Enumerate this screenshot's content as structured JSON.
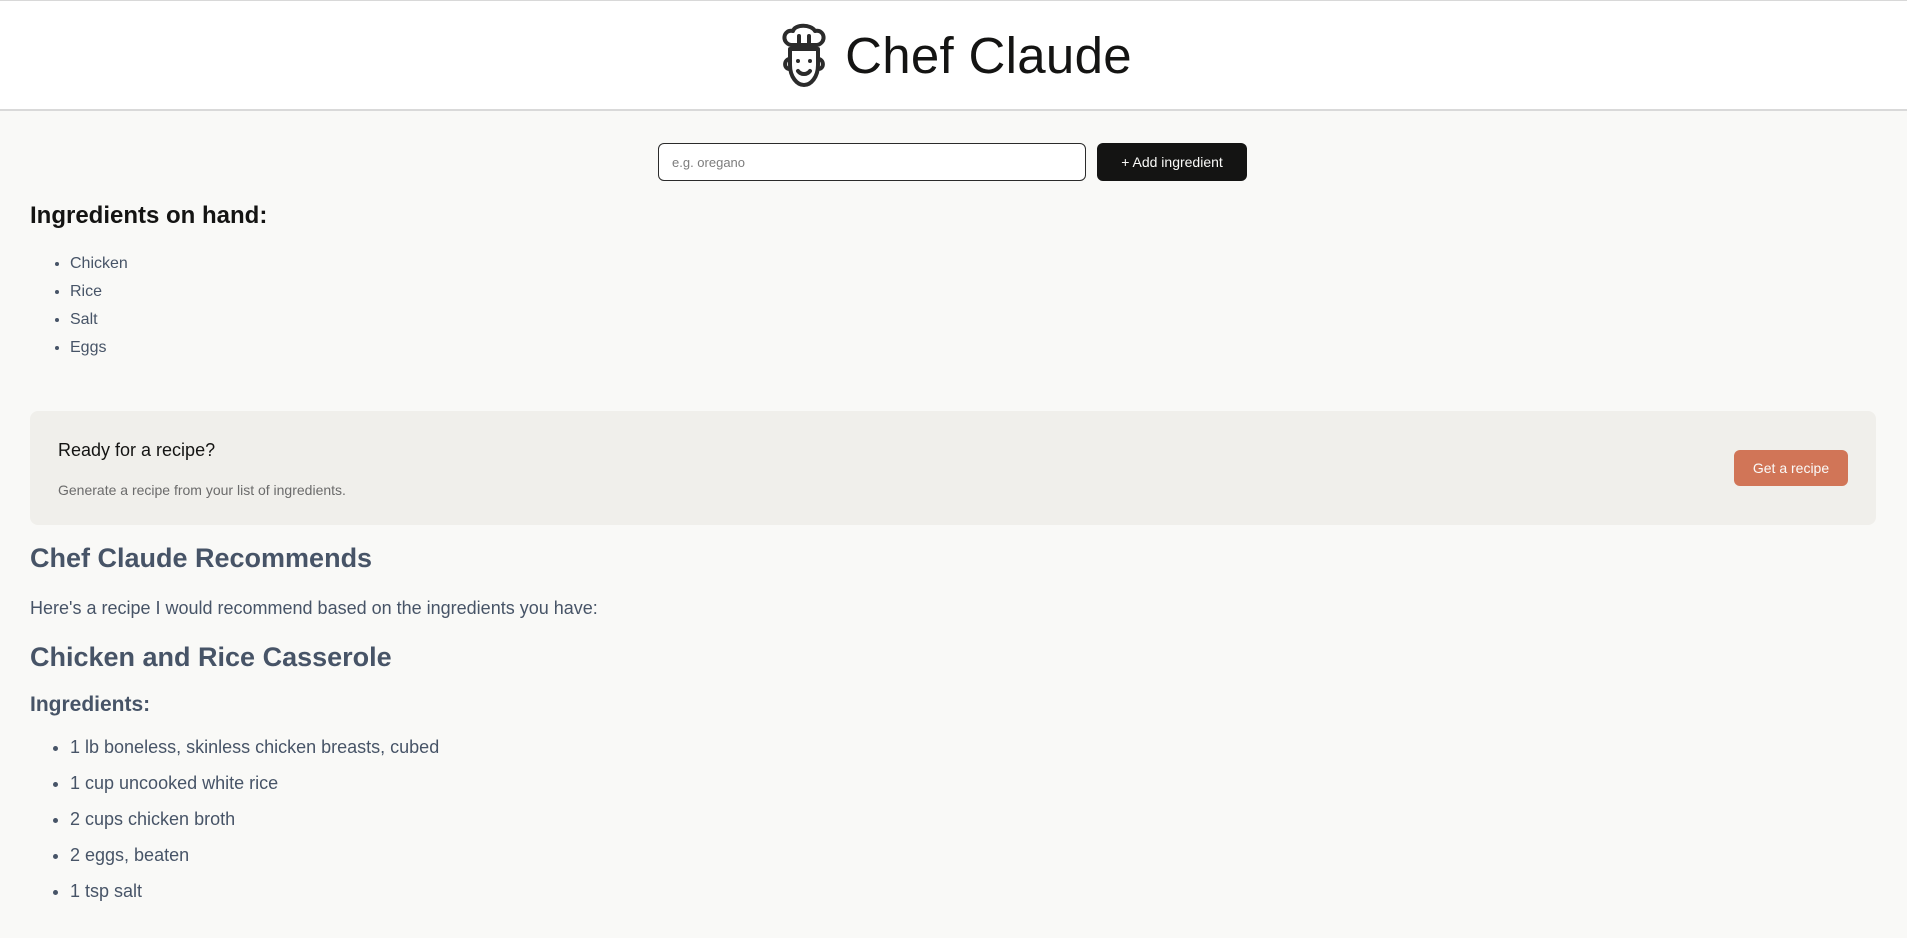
{
  "header": {
    "title": "Chef Claude",
    "logo_icon": "chef-hat-face-icon"
  },
  "add_form": {
    "placeholder": "e.g. oregano",
    "value": "",
    "button_label": "+ Add ingredient"
  },
  "on_hand": {
    "heading": "Ingredients on hand:",
    "items": [
      "Chicken",
      "Rice",
      "Salt",
      "Eggs"
    ]
  },
  "cta": {
    "title": "Ready for a recipe?",
    "subtitle": "Generate a recipe from your list of ingredients.",
    "button_label": "Get a recipe"
  },
  "recipe": {
    "section_heading": "Chef Claude Recommends",
    "intro": "Here's a recipe I would recommend based on the ingredients you have:",
    "title": "Chicken and Rice Casserole",
    "ingredients_heading": "Ingredients:",
    "ingredients": [
      "1 lb boneless, skinless chicken breasts, cubed",
      "1 cup uncooked white rice",
      "2 cups chicken broth",
      "2 eggs, beaten",
      "1 tsp salt"
    ]
  },
  "colors": {
    "background": "#f9f9f7",
    "header_bg": "#ffffff",
    "primary_button": "#141413",
    "accent_button": "#d17557",
    "cta_bg": "#f0efeb",
    "recipe_text": "#475467"
  }
}
